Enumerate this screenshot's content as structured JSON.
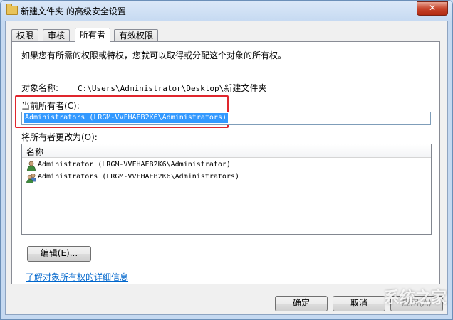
{
  "window": {
    "title": "新建文件夹 的高级安全设置",
    "close_label": "✕"
  },
  "tabs": [
    {
      "label": "权限"
    },
    {
      "label": "审核"
    },
    {
      "label": "所有者"
    },
    {
      "label": "有效权限"
    }
  ],
  "owner_tab": {
    "intro": "如果您有所需的权限或特权，您就可以取得或分配这个对象的所有权。",
    "object_name_label": "对象名称:",
    "object_path": "C:\\Users\\Administrator\\Desktop\\",
    "object_path_tail": "新建文件夹",
    "current_owner_label": "当前所有者(C):",
    "current_owner_value": "Administrators (LRGM-VVFHAEB2K6\\Administrators)",
    "change_owner_label": "将所有者更改为(O):",
    "list_column_name": "名称",
    "list_items": [
      {
        "name": "Administrator (LRGM-VVFHAEB2K6\\Administrator)",
        "icon": "user-icon"
      },
      {
        "name": "Administrators (LRGM-VVFHAEB2K6\\Administrators)",
        "icon": "group-icon"
      }
    ],
    "edit_button": "编辑(E)...",
    "learn_more_link": "了解对象所有权的详细信息"
  },
  "buttons": {
    "ok": "确定",
    "cancel": "取消",
    "apply": "应用(A)"
  },
  "watermark": "系统之家",
  "colors": {
    "selection": "#3399ff",
    "highlight_frame": "#e0262d",
    "link": "#0066cc"
  }
}
